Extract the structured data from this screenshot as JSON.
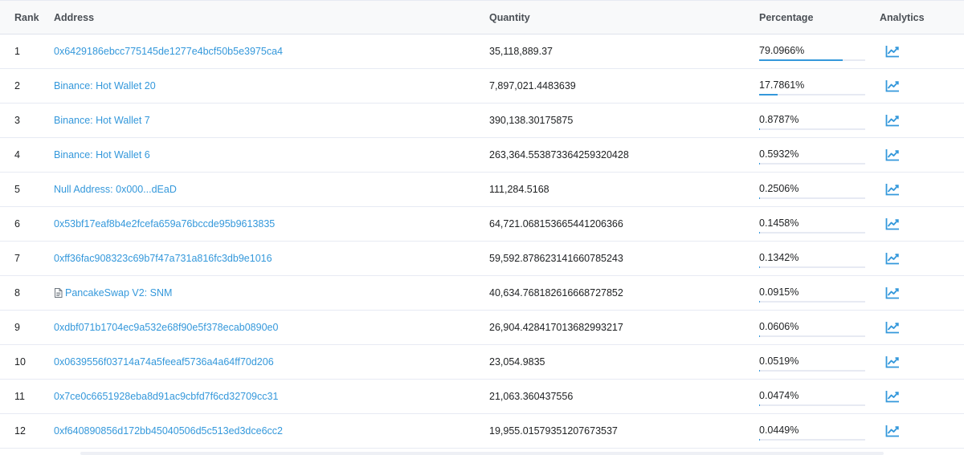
{
  "headers": {
    "rank": "Rank",
    "address": "Address",
    "quantity": "Quantity",
    "percentage": "Percentage",
    "analytics": "Analytics"
  },
  "accent_color": "#3498db",
  "rows": [
    {
      "rank": "1",
      "address": "0x6429186ebcc775145de1277e4bcf50b5e3975ca4",
      "is_contract": false,
      "quantity": "35,118,889.37",
      "percentage": "79.0966%",
      "pct_value": 79.0966
    },
    {
      "rank": "2",
      "address": "Binance: Hot Wallet 20",
      "is_contract": false,
      "quantity": "7,897,021.4483639",
      "percentage": "17.7861%",
      "pct_value": 17.7861
    },
    {
      "rank": "3",
      "address": "Binance: Hot Wallet 7",
      "is_contract": false,
      "quantity": "390,138.30175875",
      "percentage": "0.8787%",
      "pct_value": 0.8787
    },
    {
      "rank": "4",
      "address": "Binance: Hot Wallet 6",
      "is_contract": false,
      "quantity": "263,364.553873364259320428",
      "percentage": "0.5932%",
      "pct_value": 0.5932
    },
    {
      "rank": "5",
      "address": "Null Address: 0x000...dEaD",
      "is_contract": false,
      "quantity": "111,284.5168",
      "percentage": "0.2506%",
      "pct_value": 0.2506
    },
    {
      "rank": "6",
      "address": "0x53bf17eaf8b4e2fcefa659a76bccde95b9613835",
      "is_contract": false,
      "quantity": "64,721.068153665441206366",
      "percentage": "0.1458%",
      "pct_value": 0.1458
    },
    {
      "rank": "7",
      "address": "0xff36fac908323c69b7f47a731a816fc3db9e1016",
      "is_contract": false,
      "quantity": "59,592.878623141660785243",
      "percentage": "0.1342%",
      "pct_value": 0.1342
    },
    {
      "rank": "8",
      "address": "PancakeSwap V2: SNM",
      "is_contract": true,
      "quantity": "40,634.768182616668727852",
      "percentage": "0.0915%",
      "pct_value": 0.0915
    },
    {
      "rank": "9",
      "address": "0xdbf071b1704ec9a532e68f90e5f378ecab0890e0",
      "is_contract": false,
      "quantity": "26,904.428417013682993217",
      "percentage": "0.0606%",
      "pct_value": 0.0606
    },
    {
      "rank": "10",
      "address": "0x0639556f03714a74a5feeaf5736a4a64ff70d206",
      "is_contract": false,
      "quantity": "23,054.9835",
      "percentage": "0.0519%",
      "pct_value": 0.0519
    },
    {
      "rank": "11",
      "address": "0x7ce0c6651928eba8d91ac9cbfd7f6cd32709cc31",
      "is_contract": false,
      "quantity": "21,063.360437556",
      "percentage": "0.0474%",
      "pct_value": 0.0474
    },
    {
      "rank": "12",
      "address": "0xf640890856d172bb45040506d5c513ed3dce6cc2",
      "is_contract": false,
      "quantity": "19,955.01579351207673537",
      "percentage": "0.0449%",
      "pct_value": 0.0449
    }
  ]
}
